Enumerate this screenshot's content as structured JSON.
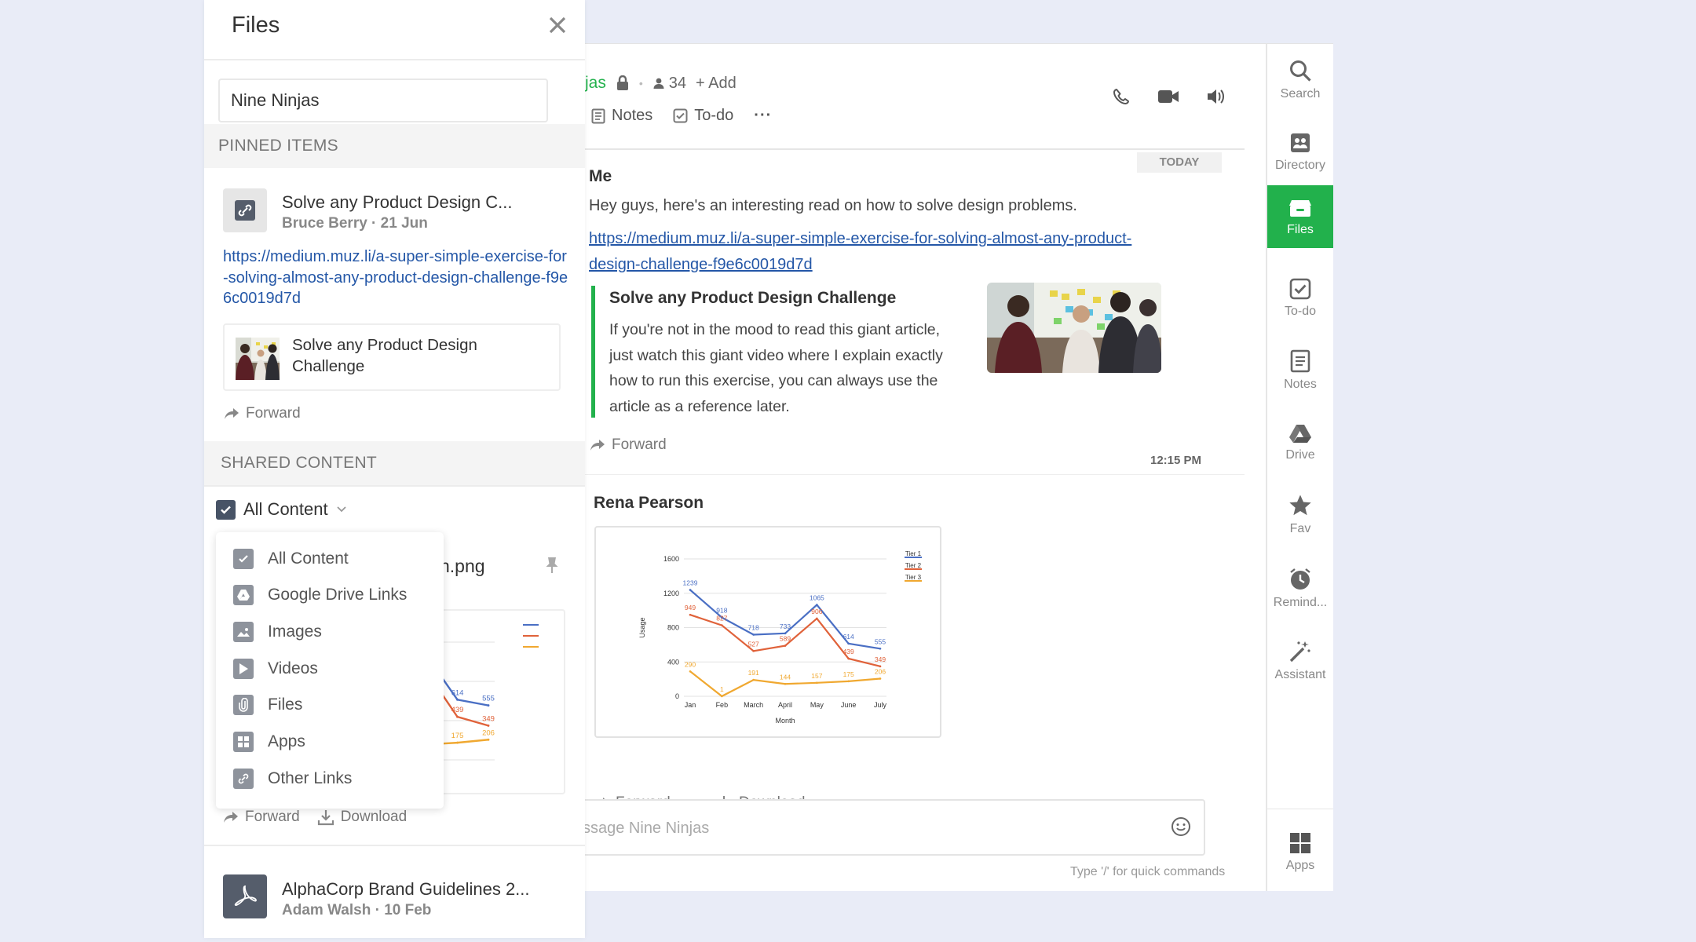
{
  "chat": {
    "channel_name": "jas",
    "member_count": "34",
    "add_label": "+ Add",
    "tabs": {
      "notes": "Notes",
      "todo": "To-do",
      "more": "···"
    },
    "date_divider": "TODAY",
    "messages": [
      {
        "sender": "Me",
        "text": "Hey guys, here's an interesting read on how to solve design problems.",
        "link": "https://medium.muz.li/a-super-simple-exercise-for-solving-almost-any-product-design-challenge-f9e6c0019d7d",
        "preview_title": "Solve any Product Design Challenge",
        "preview_desc": "If you're not in the mood to read this giant article, just watch this giant video where I explain exactly how to run this exercise, you can always use the article as a reference later.",
        "forward_label": "Forward",
        "time": "12:15 PM"
      },
      {
        "sender": "Rena Pearson",
        "forward_label": "Forward",
        "download_label": "Download"
      }
    ],
    "compose_placeholder": "ssage Nine Ninjas",
    "hint": "Type '/' for quick commands"
  },
  "rail": {
    "items": [
      {
        "label": "Search",
        "icon": "search-icon"
      },
      {
        "label": "Directory",
        "icon": "directory-icon"
      },
      {
        "label": "Files",
        "icon": "files-icon"
      },
      {
        "label": "To-do",
        "icon": "todo-icon"
      },
      {
        "label": "Notes",
        "icon": "notes-icon"
      },
      {
        "label": "Drive",
        "icon": "drive-icon"
      },
      {
        "label": "Fav",
        "icon": "star-icon"
      },
      {
        "label": "Remind...",
        "icon": "clock-icon"
      },
      {
        "label": "Assistant",
        "icon": "wand-icon"
      }
    ],
    "apps_label": "Apps",
    "active": "Files"
  },
  "files_panel": {
    "title": "Files",
    "search_value": "Nine Ninjas",
    "pinned_header": "PINNED ITEMS",
    "pinned": {
      "title": "Solve any Product Design C...",
      "meta": "Bruce Berry · 21 Jun",
      "link": "https://medium.muz.li/a-super-simple-exercise-for-solving-almost-any-product-design-challenge-f9e6c0019d7d",
      "preview_title": "Solve any Product Design Challenge",
      "forward_label": "Forward"
    },
    "shared_header": "SHARED CONTENT",
    "filter_label": "All Content",
    "filter_options": [
      "All Content",
      "Google Drive Links",
      "Images",
      "Videos",
      "Files",
      "Apps",
      "Other Links"
    ],
    "shared_item_title": "n.png",
    "forward_label": "Forward",
    "download_label": "Download",
    "doc": {
      "title": "AlphaCorp Brand Guidelines 2...",
      "meta": "Adam Walsh · 10 Feb"
    }
  },
  "colors": {
    "accent": "#22b14c",
    "link": "#2457a7",
    "tier1": "#4a6fc4",
    "tier2": "#e0623a",
    "tier3": "#f0a830"
  },
  "chart_data": {
    "type": "line",
    "categories": [
      "Jan",
      "Feb",
      "March",
      "April",
      "May",
      "June",
      "July"
    ],
    "xlabel": "Month",
    "ylabel": "Usage",
    "ylim": [
      0,
      1600
    ],
    "yticks": [
      0,
      400,
      800,
      1200,
      1600
    ],
    "legend": "top-right",
    "series": [
      {
        "name": "Tier 1",
        "values": [
          1239,
          918,
          718,
          733,
          1065,
          614,
          555
        ]
      },
      {
        "name": "Tier 2",
        "values": [
          949,
          827,
          527,
          589,
          906,
          439,
          349
        ]
      },
      {
        "name": "Tier 3",
        "values": [
          290,
          1,
          191,
          144,
          157,
          175,
          206
        ]
      }
    ]
  }
}
